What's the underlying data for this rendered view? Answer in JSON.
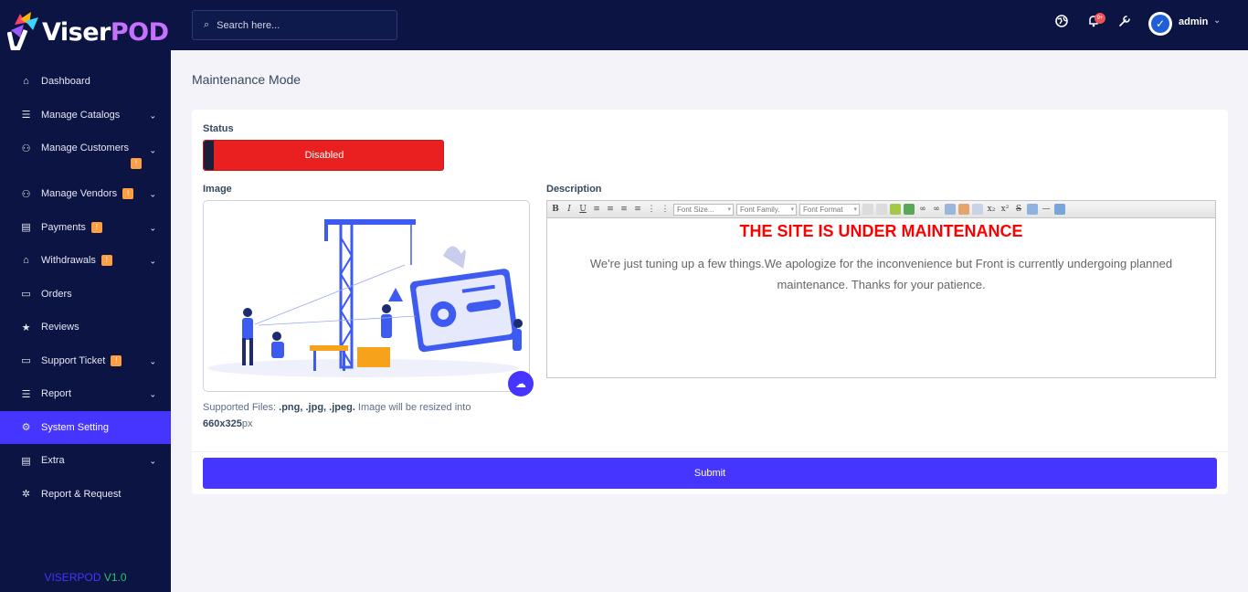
{
  "brand": {
    "part1": "Viser",
    "part2": "POD"
  },
  "version": {
    "name": "VISERPOD",
    "number": "V1.0"
  },
  "sidebar": {
    "items": [
      {
        "label": "Dashboard"
      },
      {
        "label": "Manage Catalogs"
      },
      {
        "label": "Manage Customers",
        "badge": "!"
      },
      {
        "label": "Manage Vendors",
        "badge": "!"
      },
      {
        "label": "Payments",
        "badge": "!"
      },
      {
        "label": "Withdrawals",
        "badge": "!"
      },
      {
        "label": "Orders"
      },
      {
        "label": "Reviews"
      },
      {
        "label": "Support Ticket",
        "badge": "!"
      },
      {
        "label": "Report"
      },
      {
        "label": "System Setting"
      },
      {
        "label": "Extra"
      },
      {
        "label": "Report & Request"
      }
    ]
  },
  "header": {
    "search_placeholder": "Search here...",
    "notification_count": "9+",
    "user_name": "admin"
  },
  "page": {
    "title": "Maintenance Mode",
    "status_label": "Status",
    "status_value": "Disabled",
    "image_label": "Image",
    "description_label": "Description",
    "supported_prefix": "Supported Files: ",
    "supported_types": ".png, .jpg, .jpeg.",
    "supported_mid": " Image will be resized into ",
    "supported_size": "660x325",
    "supported_unit": "px",
    "submit_label": "Submit"
  },
  "editor": {
    "toolbar": {
      "font_size": "Font Size...",
      "font_family": "Font Family.",
      "font_format": "Font Format"
    },
    "heading": "THE SITE IS UNDER MAINTENANCE",
    "body": "We're just tuning up a few things.We apologize for the inconvenience but Front is currently undergoing planned maintenance. Thanks for your patience."
  },
  "colors": {
    "sidebar_bg": "#0b1442",
    "accent": "#4634ff",
    "danger": "#ea1f1f",
    "badge_warning": "#ff9f43",
    "heading_red": "#ff0000"
  }
}
